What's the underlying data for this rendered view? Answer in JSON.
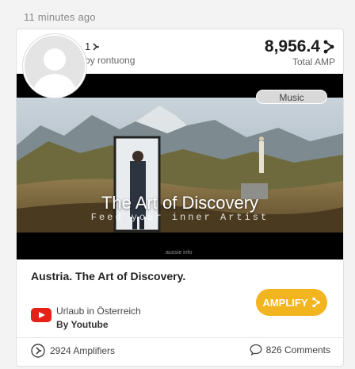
{
  "post": {
    "timestamp": "11 minutes ago",
    "amp_count": "1",
    "byline": "by rontuong",
    "total_value": "8,956.4",
    "total_label": "Total AMP",
    "genre_tag": "Music",
    "overlay_title": "The Art of Discovery",
    "overlay_subtitle": "Feed your inner Artist",
    "watermark": "aussie info",
    "title": "Austria. The Art of Discovery.",
    "source_name": "Urlaub in Österreich",
    "source_by": "By Youtube",
    "amplify_label": "AMPLIFY",
    "amplifiers": "2924 Amplifiers",
    "comments": "826 Comments"
  },
  "colors": {
    "amplify": "#f2b51f",
    "youtube": "#e62117"
  },
  "icons": {
    "amp": "amp-icon",
    "comment": "comment-icon",
    "youtube": "youtube-icon",
    "avatar": "avatar-placeholder"
  }
}
